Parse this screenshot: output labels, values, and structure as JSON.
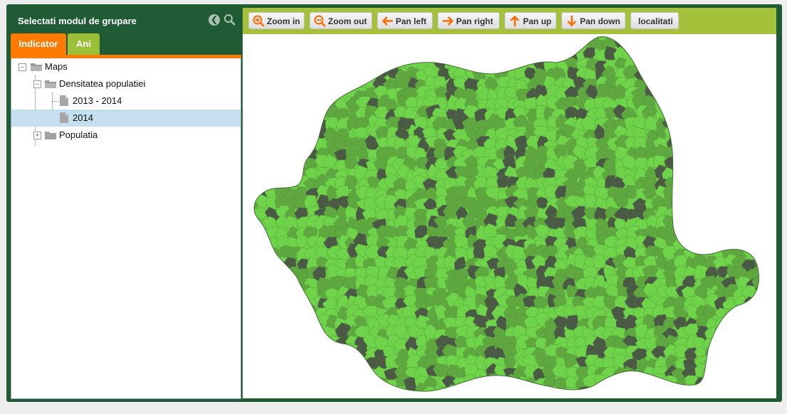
{
  "panel": {
    "title": "Selectati modul de grupare",
    "tabs": [
      {
        "label": "Indicator",
        "active": true
      },
      {
        "label": "Ani",
        "active": false
      }
    ]
  },
  "tree": {
    "root": "Maps",
    "group1": "Densitatea populatiei",
    "item1": "2013 - 2014",
    "item2": "2014",
    "group2": "Populatia",
    "selected": "2014"
  },
  "toolbar": {
    "zoom_in": "Zoom in",
    "zoom_out": "Zoom out",
    "pan_left": "Pan left",
    "pan_right": "Pan right",
    "pan_up": "Pan up",
    "pan_down": "Pan down",
    "localitati": "localitati"
  },
  "colors": {
    "frame": "#1f5c36",
    "tab_active": "#ff7a00",
    "tab_inactive": "#9bc038",
    "toolbar": "#a5c13c",
    "map_light": "#6fd44a",
    "map_mid": "#5fa83f",
    "map_dark": "#4a5a45",
    "selection": "#c5dff1"
  }
}
